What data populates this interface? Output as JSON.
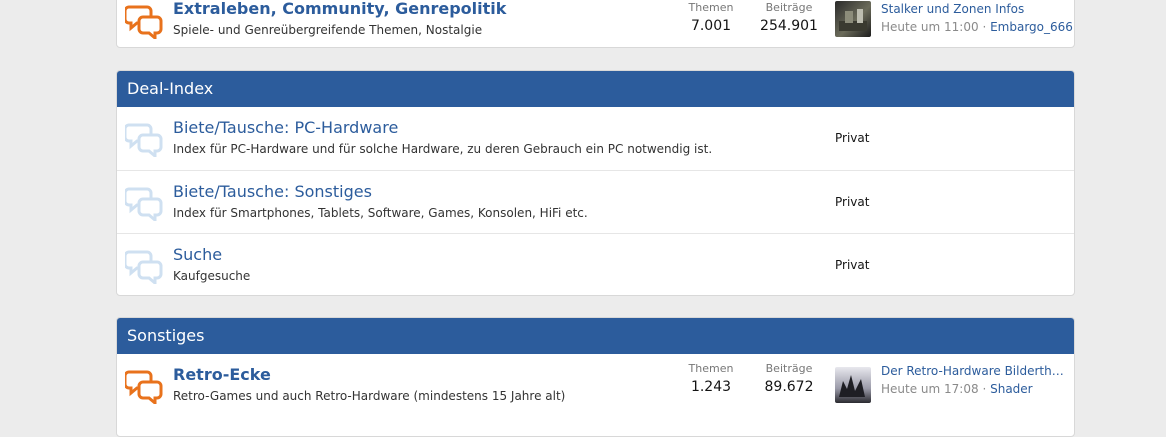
{
  "top_forum": {
    "title": "Extraleben, Community, Genrepolitik",
    "description": "Spiele- und Genreübergreifende Themen, Nostalgie",
    "threads_label": "Themen",
    "threads_value": "7.001",
    "posts_label": "Beiträge",
    "posts_value": "254.901",
    "last_post_title": "Stalker und Zonen Infos",
    "last_post_time": "Heute um 11:00",
    "last_post_sep": "·",
    "last_post_user": "Embargo_666"
  },
  "deal_index": {
    "header": "Deal-Index",
    "forums": [
      {
        "title": "Biete/Tausche: PC-Hardware",
        "description": "Index für PC-Hardware und für solche Hardware, zu deren Gebrauch ein PC notwendig ist.",
        "status": "Privat"
      },
      {
        "title": "Biete/Tausche: Sonstiges",
        "description": "Index für Smartphones, Tablets, Software, Games, Konsolen, HiFi etc.",
        "status": "Privat"
      },
      {
        "title": "Suche",
        "description": "Kaufgesuche",
        "status": "Privat"
      }
    ]
  },
  "sonstiges": {
    "header": "Sonstiges",
    "forum": {
      "title": "Retro-Ecke",
      "description": "Retro-Games und auch Retro-Hardware (mindestens 15 Jahre alt)",
      "threads_label": "Themen",
      "threads_value": "1.243",
      "posts_label": "Beiträge",
      "posts_value": "89.672",
      "last_post_title": "Der Retro-Hardware Bilderthr…",
      "last_post_time": "Heute um 17:08",
      "last_post_sep": "·",
      "last_post_user": "Shader"
    }
  },
  "colors": {
    "header_bg": "#2c5c9c",
    "link": "#2c5c9c",
    "unread_icon": "#e8721c",
    "read_icon": "#cfe0f1"
  },
  "icons": {
    "unread_forum": "speech-bubbles-icon",
    "read_forum": "speech-bubbles-icon"
  }
}
